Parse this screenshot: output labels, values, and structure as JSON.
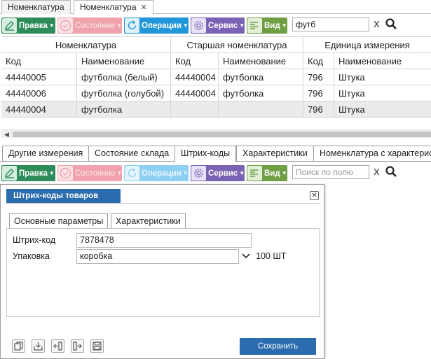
{
  "top_tabs": [
    {
      "label": "Номенклатура",
      "active": false
    },
    {
      "label": "Номенклатура",
      "active": true
    }
  ],
  "toolbar1": {
    "edit": "Правка",
    "state": "Состояние",
    "operations": "Операции",
    "service": "Сервис",
    "view": "Вид",
    "search_value": "футб",
    "clear": "X"
  },
  "grid": {
    "group_headers": [
      "Номенклатура",
      "Старшая номенклатура",
      "Единица измерения"
    ],
    "sub_headers": [
      "Код",
      "Наименование",
      "Код",
      "Наименование",
      "Код",
      "Наименование"
    ],
    "rows": [
      [
        "44440005",
        "футболка (белый)",
        "44440004",
        "футболка",
        "796",
        "Штука"
      ],
      [
        "44440006",
        "футболка (голубой)",
        "44440004",
        "футболка",
        "796",
        "Штука"
      ],
      [
        "44440004",
        "футболка",
        "",
        "",
        "796",
        "Штука"
      ]
    ]
  },
  "bottom_tabs": [
    {
      "label": "Другие измерения",
      "active": false
    },
    {
      "label": "Состояние склада",
      "active": false
    },
    {
      "label": "Штрих-коды",
      "active": true
    },
    {
      "label": "Характеристики",
      "active": false
    },
    {
      "label": "Номенклатура с характеристикой",
      "active": false
    }
  ],
  "toolbar2": {
    "edit": "Правка",
    "state": "Состояние",
    "operations": "Операции",
    "service": "Сервис",
    "view": "Вид",
    "search_placeholder": "Поиск по полю",
    "clear": "X"
  },
  "modal": {
    "title": "Штрих-коды товаров",
    "close": "✕",
    "tabs": [
      "Основные параметры",
      "Характеристики"
    ],
    "barcode_label": "Штрих-код",
    "barcode_value": "7878478",
    "package_label": "Упаковка",
    "package_value": "коробка",
    "package_qty": "100 ШТ",
    "save": "Сохранить"
  },
  "colors": {
    "edit": "#2e8b5a",
    "state": "#f0a3ac",
    "operations": "#2196d8",
    "service": "#7a62b4",
    "view": "#6f9e45",
    "accent": "#2a6cad"
  }
}
